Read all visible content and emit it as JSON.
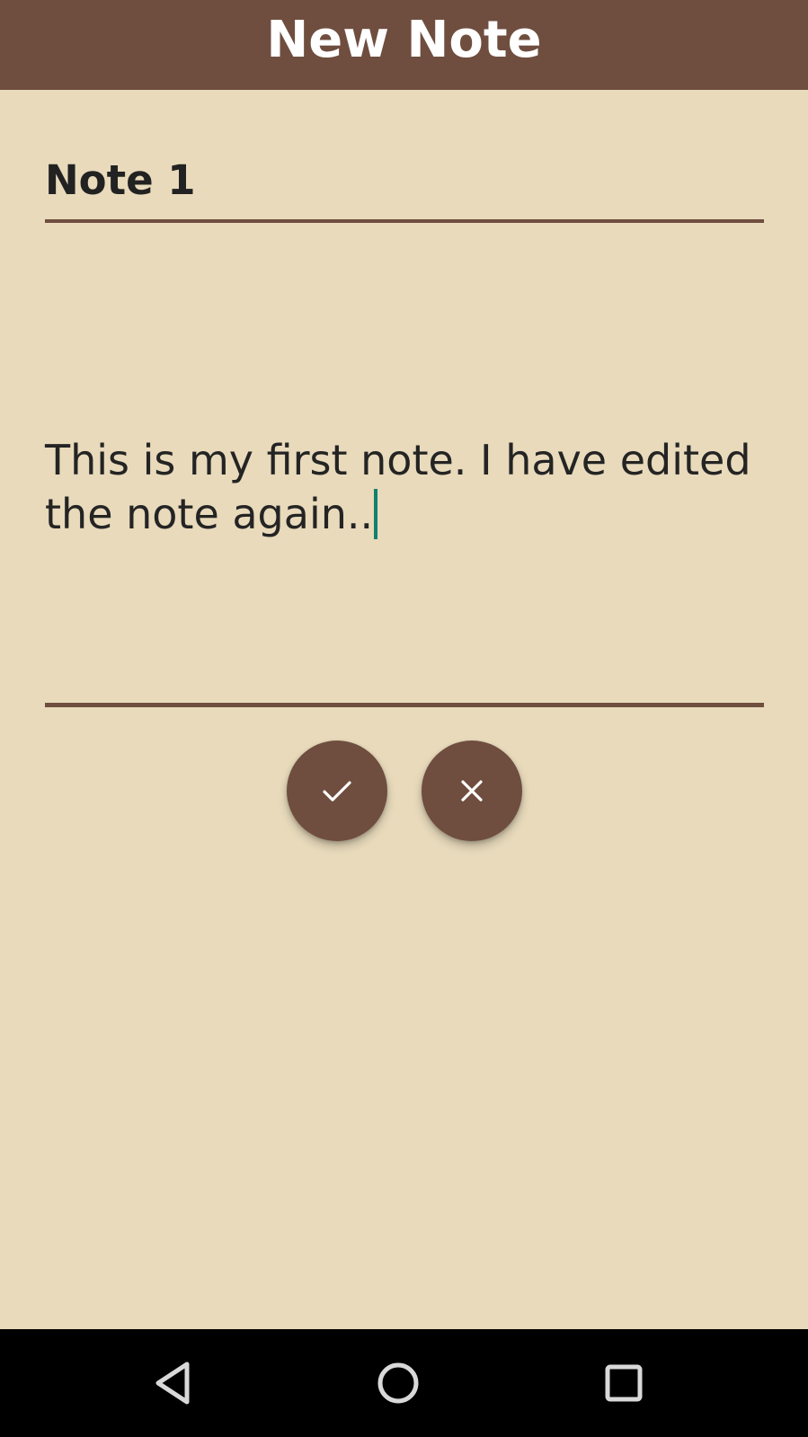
{
  "app_bar": {
    "title": "New Note",
    "background_color": "#6F4E3F",
    "title_color": "#FFFFFF"
  },
  "editor": {
    "title_value": "Note 1",
    "body_value": "This is my first note. I have edited the note again..",
    "underline_color": "#6F4E3F",
    "caret_color": "#13806F"
  },
  "actions": {
    "save_icon": "check-icon",
    "cancel_icon": "close-icon",
    "button_color": "#6F4E3F"
  },
  "system_nav": {
    "back_icon": "triangle-back-icon",
    "home_icon": "circle-home-icon",
    "recents_icon": "square-recents-icon"
  },
  "theme": {
    "background": "#E8DABB"
  }
}
